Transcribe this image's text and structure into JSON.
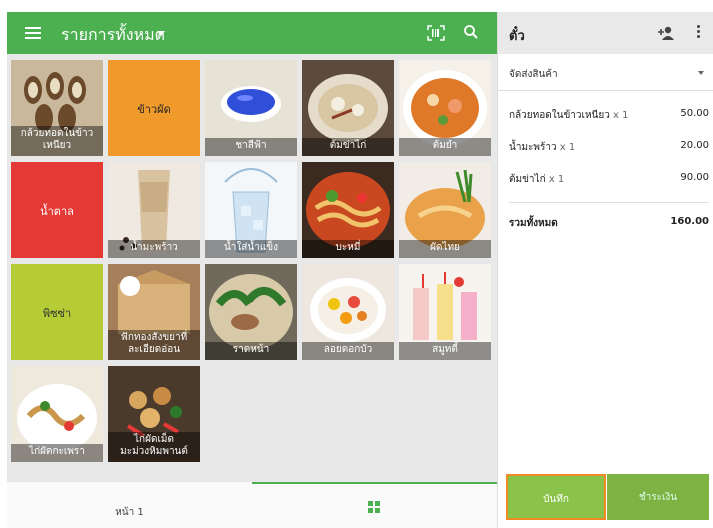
{
  "header": {
    "category_title": "รายการทั้งหมด"
  },
  "items": [
    {
      "name": "กล้วยทอดในข้าวเหนียว"
    },
    {
      "name": "ข้าวผัด"
    },
    {
      "name": "ชาสีฟ้า"
    },
    {
      "name": "ต้มข่าไก่"
    },
    {
      "name": "ต้มยำ"
    },
    {
      "name": "น้ำตาล"
    },
    {
      "name": "น้ำมะพร้าว"
    },
    {
      "name": "น้ำใส่น้ำแข็ง"
    },
    {
      "name": "บะหมี่"
    },
    {
      "name": "ผัดไทย"
    },
    {
      "name": "พิซซ่า"
    },
    {
      "name": "ฟักทองสังขยาที่ละเอียดอ่อน"
    },
    {
      "name": "ราดหน้า"
    },
    {
      "name": "ลอยดอกบัว"
    },
    {
      "name": "สมูทตี้"
    },
    {
      "name": "ไก่ผัดกะเพรา"
    },
    {
      "name": "ไก่ผัดเม็ดมะม่วงหิมพานต์"
    }
  ],
  "footer": {
    "page_label": "หน้า 1"
  },
  "ticket": {
    "title": "ตั๋ว",
    "dining_option": "จัดส่งสินค้า",
    "lines": [
      {
        "name": "กล้วยทอดในข้าวเหนียว",
        "qty": "x 1",
        "price": "50.00"
      },
      {
        "name": "น้ำมะพร้าว",
        "qty": "x 1",
        "price": "20.00"
      },
      {
        "name": "ต้มข่าไก่",
        "qty": "x 1",
        "price": "90.00"
      }
    ],
    "total_label": "รวมทั้งหมด",
    "total_value": "160.00",
    "save_label": "บันทึก",
    "pay_label": "ชำระเงิน"
  },
  "colors": {
    "primary_green": "#4caf50",
    "save_green": "#8bc34a",
    "pay_green": "#7cb342",
    "orange_tile": "#f19a2c",
    "red_tile": "#e53935",
    "lime_tile": "#b5cc36",
    "highlight_border": "#f08a24"
  }
}
